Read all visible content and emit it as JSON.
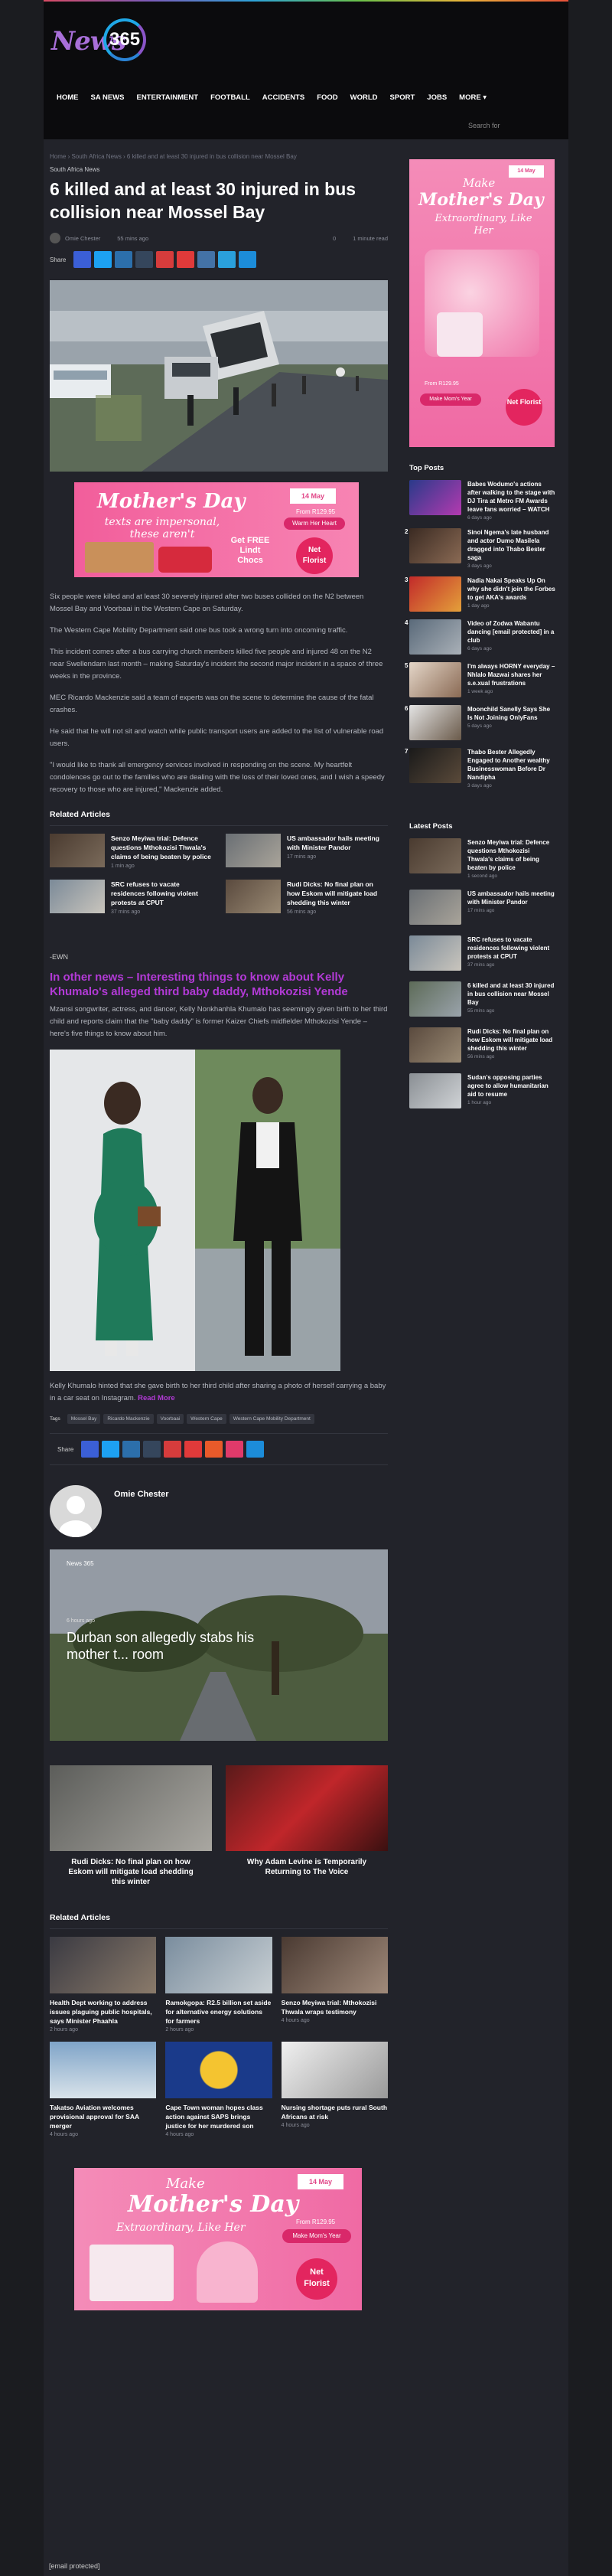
{
  "nav": [
    "HOME",
    "SA NEWS",
    "ENTERTAINMENT",
    "FOOTBALL",
    "ACCIDENTS",
    "FOOD",
    "WORLD",
    "SPORT",
    "JOBS",
    "MORE ▾"
  ],
  "search_label": "Search for",
  "logo": {
    "word": "News",
    "num": "365"
  },
  "article": {
    "breadcrumb": "Home › South Africa News › 6 killed and at least 30 injured in bus collision near Mossel Bay",
    "category": "South Africa News",
    "title": "6 killed and at least 30 injured in bus collision near Mossel Bay",
    "author": "Omie Chester",
    "time": "55 mins ago",
    "comments": "0",
    "read": "1 minute read",
    "share_label": "Share",
    "paragraphs": [
      "Six people were killed and at least 30 severely injured after two buses collided on the N2 between Mossel Bay and Voorbaai in the Western Cape on Saturday.",
      "The Western Cape Mobility Department said one bus took a wrong turn into oncoming traffic.",
      "This incident comes after a bus carrying church members killed five people and injured 48 on the N2 near Swellendam last month – making Saturday's incident the second major incident in a space of three weeks in the province.",
      "MEC Ricardo Mackenzie said a team of experts was on the scene to determine the cause of the fatal crashes.",
      "He said that he will not sit and watch while public transport users are added to the list of vulnerable road users.",
      "\"I would like to thank all emergency services involved in responding on the scene. My heartfelt condolences go out to the families who are dealing with the loss of their loved ones, and I wish a speedy recovery to those who are injured,\" Mackenzie added."
    ],
    "source": "-EWN",
    "other_news_title": "In other news – Interesting things to know about Kelly Khumalo's alleged third baby daddy, Mthokozisi Yende",
    "other_news_body": "Mzansi songwriter, actress, and dancer, Kelly Nonkhanhla Khumalo has seemingly given birth to her third child and reports claim that the \"baby daddy\" is former Kaizer Chiefs midfielder Mthokozisi Yende – here's five things to know about him.",
    "caption": "Kelly Khumalo hinted that she gave birth to her third child after sharing a photo of herself carrying a baby in a car seat on Instagram.",
    "more_link": "Read More",
    "tags_label": "Tags",
    "tags": [
      "Mossel Bay",
      "Ricardo Mackenzie",
      "Voorbaai",
      "Western Cape",
      "Western Cape Mobility Department"
    ]
  },
  "related_title": "Related Articles",
  "related": [
    {
      "title": "Senzo Meyiwa trial: Defence questions Mthokozisi Thwala's claims of being beaten by police",
      "time": "1 min ago"
    },
    {
      "title": "US ambassador hails meeting with Minister Pandor",
      "time": "17 mins ago"
    },
    {
      "title": "SRC refuses to vacate residences following violent protests at CPUT",
      "time": "37 mins ago"
    },
    {
      "title": "Rudi Dicks: No final plan on how Eskom will mitigate load shedding this winter",
      "time": "56 mins ago"
    }
  ],
  "author_box": {
    "name": "Omie Chester"
  },
  "featured": {
    "label": "News 365",
    "time": "6 hours ago",
    "title": "Durban son allegedly stabs his mother t... room"
  },
  "featured_pair": [
    {
      "title": "Rudi Dicks: No final plan on how Eskom will mitigate load shedding this winter"
    },
    {
      "title": "Why Adam Levine is Temporarily Returning to The Voice"
    }
  ],
  "related2_title": "Related Articles",
  "related2": [
    {
      "title": "Health Dept working to address issues plaguing public hospitals, says Minister Phaahla",
      "time": "2 hours ago"
    },
    {
      "title": "Ramokgopa: R2.5 billion set aside for alternative energy solutions for farmers",
      "time": "2 hours ago"
    },
    {
      "title": "Senzo Meyiwa trial: Mthokozisi Thwala wraps testimony",
      "time": "4 hours ago"
    },
    {
      "title": "Takatso Aviation welcomes provisional approval for SAA merger",
      "time": "4 hours ago"
    },
    {
      "title": "Cape Town woman hopes class action against SAPS brings justice for her murdered son",
      "time": "4 hours ago"
    },
    {
      "title": "Nursing shortage puts rural South Africans at risk",
      "time": "4 hours ago"
    }
  ],
  "top_posts_title": "Top Posts",
  "top_posts": [
    {
      "title": "Babes Wodumo's actions after walking to the stage with DJ Tira at Metro FM Awards leave fans worried – WATCH",
      "time": "6 days ago"
    },
    {
      "title": "Sinoi Ngema's late husband and actor Dumo Masilela dragged into Thabo Bester saga",
      "time": "3 days ago"
    },
    {
      "title": "Nadia Nakai Speaks Up On why she didn't join the Forbes to get AKA's awards",
      "time": "1 day ago"
    },
    {
      "title": "Video of Zodwa Wabantu dancing [email protected] in a club",
      "time": "6 days ago"
    },
    {
      "title": "I'm always HORNY everyday – Nhlalo Mazwai shares her s.e.xual frustrations",
      "time": "1 week ago"
    },
    {
      "title": "Moonchild Sanelly Says She Is Not Joining OnlyFans",
      "time": "5 days ago"
    },
    {
      "title": "Thabo Bester Allegedly Engaged to Another wealthy Businesswoman Before Dr Nandipha",
      "time": "3 days ago"
    }
  ],
  "latest_title": "Latest Posts",
  "latest": [
    {
      "title": "Senzo Meyiwa trial: Defence questions Mthokozisi Thwala's claims of being beaten by police",
      "time": "1 second ago"
    },
    {
      "title": "US ambassador hails meeting with Minister Pandor",
      "time": "17 mins ago"
    },
    {
      "title": "SRC refuses to vacate residences following violent protests at CPUT",
      "time": "37 mins ago"
    },
    {
      "title": "6 killed and at least 30 injured in bus collision near Mossel Bay",
      "time": "55 mins ago"
    },
    {
      "title": "Rudi Dicks: No final plan on how Eskom will mitigate load shedding this winter",
      "time": "56 mins ago"
    },
    {
      "title": "Sudan's opposing parties agree to allow humanitarian aid to resume",
      "time": "1 hour ago"
    }
  ],
  "ads": {
    "make": "Make",
    "mothers_day": "Mother's Day",
    "extraordinary": "Extraordinary, Like Her",
    "impersonal": "texts are impersonal, these aren't",
    "date": "14 May",
    "from": "From R129.95",
    "warm": "Warm Her Heart",
    "make_moms": "Make Mom's Year",
    "free": "Get FREE Lindt Chocs",
    "netflorist": "Net Florist"
  },
  "footer": "[email protected]"
}
